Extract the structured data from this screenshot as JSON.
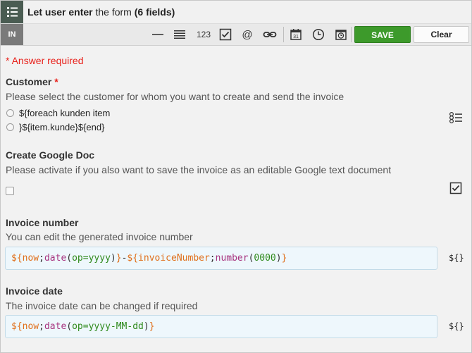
{
  "header": {
    "title_part1": "Let user",
    "title_part2": "enter",
    "title_part3": "the form",
    "title_part4": "(6 fields)",
    "menu_icon": "list-menu-icon"
  },
  "toolbar": {
    "in_label": "IN",
    "number_tool": "123",
    "at_tool": "@",
    "save_label": "SAVE",
    "clear_label": "Clear",
    "accent": "#3d9a2b"
  },
  "form": {
    "required_note": "* Answer required",
    "customer": {
      "label": "Customer",
      "required_mark": "*",
      "description": "Please select the customer for whom you want to create and send the invoice",
      "options": [
        "${foreach kunden item",
        "}${item.kunde}${end}"
      ],
      "side_icon": "radio-list-icon"
    },
    "google_doc": {
      "label": "Create Google Doc",
      "description": "Please activate if you also want to save the invoice as an editable Google text document",
      "side_icon": "checkbox-checked-icon"
    },
    "invoice_number": {
      "label": "Invoice number",
      "description": "You can edit the generated invoice number",
      "tokens": [
        "${",
        "now",
        ";",
        "date",
        "(",
        "op=yyyy",
        ")",
        "}",
        "-",
        "${",
        "invoiceNumber",
        ";",
        "number",
        "(",
        "0000",
        ")",
        "}"
      ],
      "side_icon_text": "${}"
    },
    "invoice_date": {
      "label": "Invoice date",
      "description": "The invoice date can be changed if required",
      "tokens": [
        "${",
        "now",
        ";",
        "date",
        "(",
        "op=yyyy-MM-dd",
        ")",
        "}"
      ],
      "side_icon_text": "${}"
    }
  }
}
